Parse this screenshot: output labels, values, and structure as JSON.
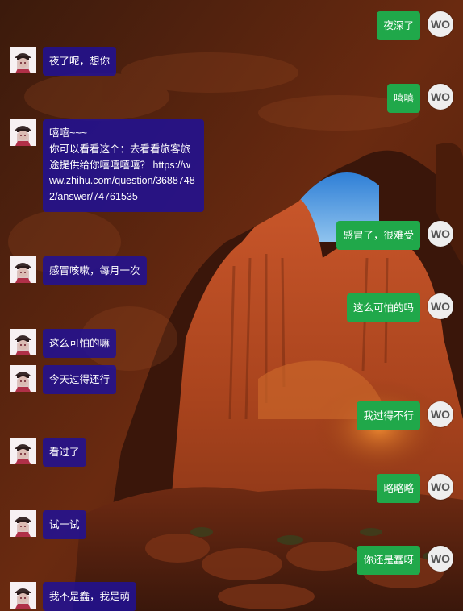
{
  "chat": {
    "my_avatar_text": "WO",
    "messages": [
      {
        "side": "me",
        "text": "夜深了"
      },
      {
        "side": "other",
        "text": "夜了呢，想你"
      },
      {
        "side": "me",
        "text": "嘻嘻"
      },
      {
        "side": "other",
        "text": "嘻嘻~~~\n你可以看看这个：去看看旅客旅途提供给你嘻嘻嘻嘻？ https://www.zhihu.com/question/36887482/answer/74761535"
      },
      {
        "side": "me",
        "text": "感冒了，很难受"
      },
      {
        "side": "other",
        "text": "感冒咳嗽，每月一次"
      },
      {
        "side": "me",
        "text": "这么可怕的吗"
      },
      {
        "side": "other",
        "text": "这么可怕的嘛"
      },
      {
        "side": "other",
        "text": "今天过得还行"
      },
      {
        "side": "me",
        "text": "我过得不行"
      },
      {
        "side": "other",
        "text": "看过了"
      },
      {
        "side": "me",
        "text": "略略略"
      },
      {
        "side": "other",
        "text": "试一试"
      },
      {
        "side": "me",
        "text": "你还是蠢呀"
      },
      {
        "side": "other",
        "text": "我不是蠢，我是萌"
      }
    ]
  },
  "colors": {
    "my_bubble": "#20a84a",
    "other_bubble": "#2010a0",
    "avatar_bg": "#eeeeee"
  }
}
